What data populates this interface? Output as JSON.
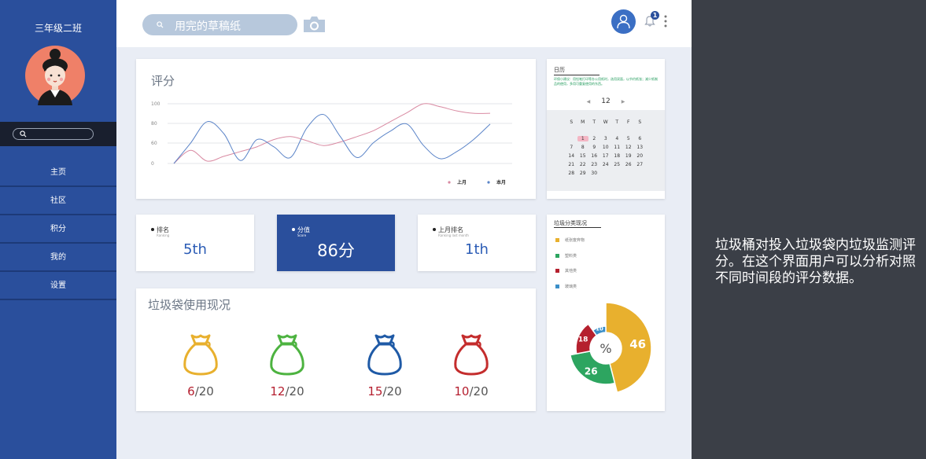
{
  "sidebar": {
    "class_name": "三年级二班",
    "search_placeholder": "",
    "items": [
      {
        "label": "主页"
      },
      {
        "label": "社区"
      },
      {
        "label": "积分"
      },
      {
        "label": "我的"
      },
      {
        "label": "设置"
      }
    ]
  },
  "topbar": {
    "search_query": "用完的草稿纸",
    "notification_count": "1"
  },
  "score_chart": {
    "title": "评分",
    "chart_data": {
      "type": "line",
      "x": [
        0,
        1,
        2,
        3,
        4,
        5,
        6,
        7,
        8,
        9,
        10,
        11,
        12,
        13,
        14,
        15,
        16,
        17,
        18,
        19
      ],
      "ylim": [
        0,
        100
      ],
      "yticks": [
        "100",
        "80",
        "60",
        "0"
      ],
      "grid": true,
      "legend_position": "bottom-right",
      "series": [
        {
          "name": "上月",
          "color": "#d98aa2",
          "values": [
            0,
            22,
            4,
            12,
            20,
            28,
            40,
            45,
            38,
            30,
            36,
            45,
            55,
            70,
            85,
            100,
            95,
            88,
            84,
            84
          ]
        },
        {
          "name": "本月",
          "color": "#5b84c8",
          "values": [
            0,
            34,
            70,
            50,
            5,
            40,
            28,
            10,
            60,
            82,
            45,
            10,
            35,
            54,
            66,
            30,
            8,
            20,
            40,
            66
          ]
        }
      ]
    }
  },
  "stats": [
    {
      "label": "排名",
      "sublabel": "Ranking",
      "value": "5th"
    },
    {
      "label": "分值",
      "sublabel": "Score",
      "value": "86分"
    },
    {
      "label": "上月排名",
      "sublabel": "Ranking last month",
      "value": "1th"
    }
  ],
  "bags": {
    "title": "垃圾袋使用现况",
    "items": [
      {
        "used": "6",
        "total": "/20",
        "color": "#e8b02e"
      },
      {
        "used": "12",
        "total": "/20",
        "color": "#4db340"
      },
      {
        "used": "15",
        "total": "/20",
        "color": "#1f5aa6"
      },
      {
        "used": "10",
        "total": "/20",
        "color": "#c42d2d"
      }
    ]
  },
  "calendar": {
    "title": "日历",
    "note": "环保小建议：用铅笔打印等办公用纸时，选用双面，以节约纸张；减少纸制品的使用，多用可重复使用的东西。",
    "month": "12",
    "weekdays": [
      "S",
      "M",
      "T",
      "W",
      "T",
      "F",
      "S"
    ],
    "weeks": [
      [
        "",
        "1",
        "2",
        "3",
        "4",
        "5",
        "6"
      ],
      [
        "7",
        "8",
        "9",
        "10",
        "11",
        "12",
        "13"
      ],
      [
        "14",
        "15",
        "16",
        "17",
        "18",
        "19",
        "20"
      ],
      [
        "21",
        "22",
        "23",
        "24",
        "25",
        "26",
        "27"
      ],
      [
        "28",
        "29",
        "30",
        "",
        "",
        "",
        ""
      ]
    ],
    "highlight_day": "1"
  },
  "classification": {
    "title": "垃圾分类现况",
    "center_label": "%",
    "chart_data": {
      "type": "pie",
      "slices": [
        {
          "name": "纸张废弃物",
          "value": 46,
          "color": "#e8b02e"
        },
        {
          "name": "塑料类",
          "value": 26,
          "color": "#2da560"
        },
        {
          "name": "其他类",
          "value": 18,
          "color": "#b5202e"
        },
        {
          "name": "玻璃类",
          "value": 10,
          "color": "#3b8fc8"
        }
      ]
    }
  },
  "description": "垃圾桶对投入垃圾袋内垃圾监测评分。在这个界面用户可以分析对照不同时间段的评分数据。"
}
